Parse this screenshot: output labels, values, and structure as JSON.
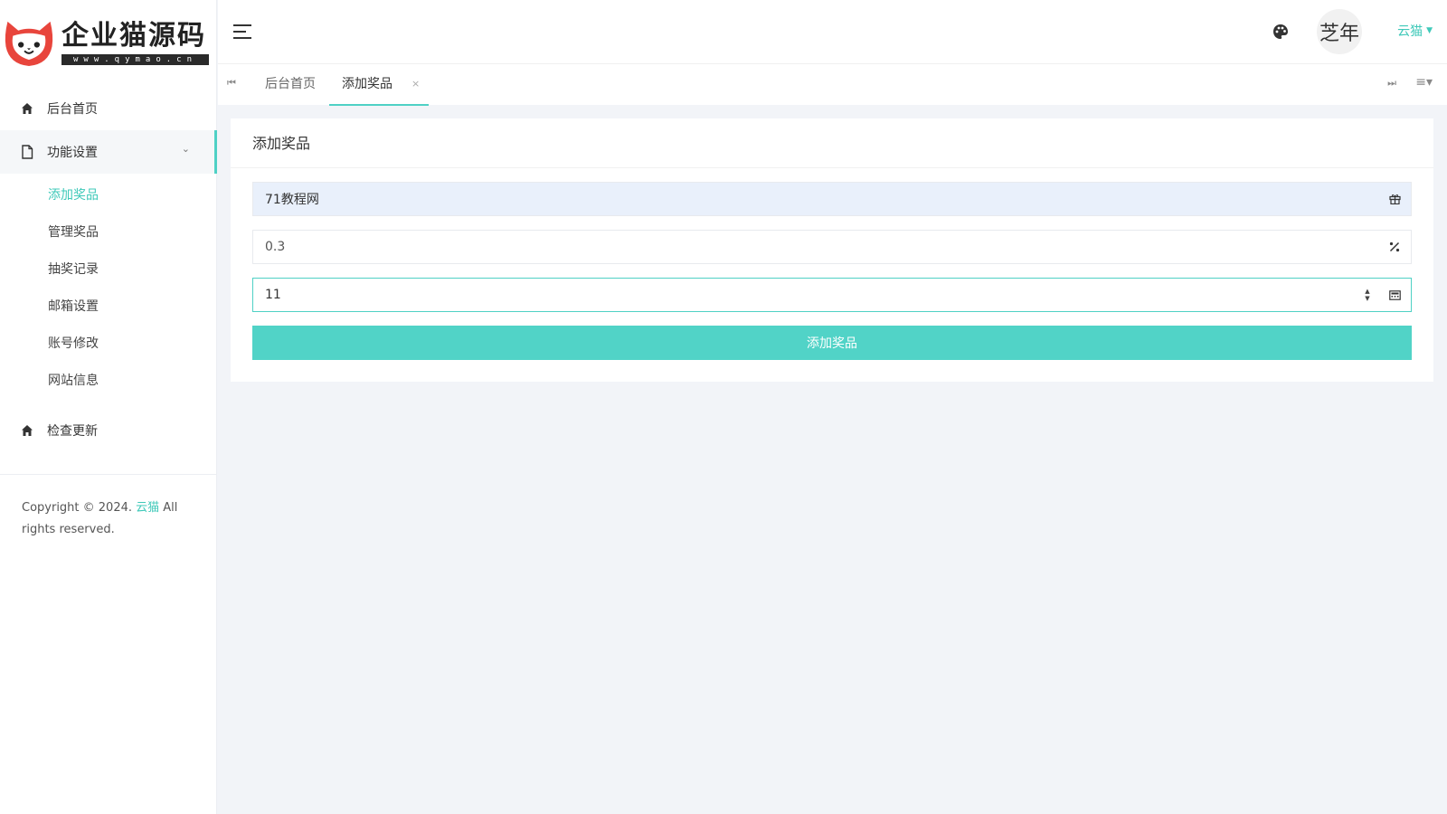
{
  "logo": {
    "name": "企业猫源码",
    "url": "www.qymao.cn"
  },
  "sidebar": {
    "items": [
      {
        "label": "后台首页",
        "icon": "home-icon"
      },
      {
        "label": "功能设置",
        "icon": "file-icon"
      }
    ],
    "submenu": [
      {
        "label": "添加奖品"
      },
      {
        "label": "管理奖品"
      },
      {
        "label": "抽奖记录"
      },
      {
        "label": "邮箱设置"
      },
      {
        "label": "账号修改"
      },
      {
        "label": "网站信息"
      }
    ],
    "last_item": {
      "label": "检查更新",
      "icon": "home-icon"
    },
    "footer": {
      "prefix": "Copyright © 2024. ",
      "brand": "云猫",
      "suffix": " All rights reserved."
    }
  },
  "header": {
    "avatar_text": "芝年",
    "user_name": "云猫"
  },
  "tabs": [
    {
      "label": "后台首页"
    },
    {
      "label": "添加奖品",
      "close": "×"
    }
  ],
  "form": {
    "title": "添加奖品",
    "prize_name": "71教程网",
    "probability": "0.3",
    "quantity": "11",
    "submit_label": "添加奖品"
  },
  "colors": {
    "accent": "#4fd1c5",
    "button": "#51d3c7",
    "logo_red": "#e8453c"
  }
}
